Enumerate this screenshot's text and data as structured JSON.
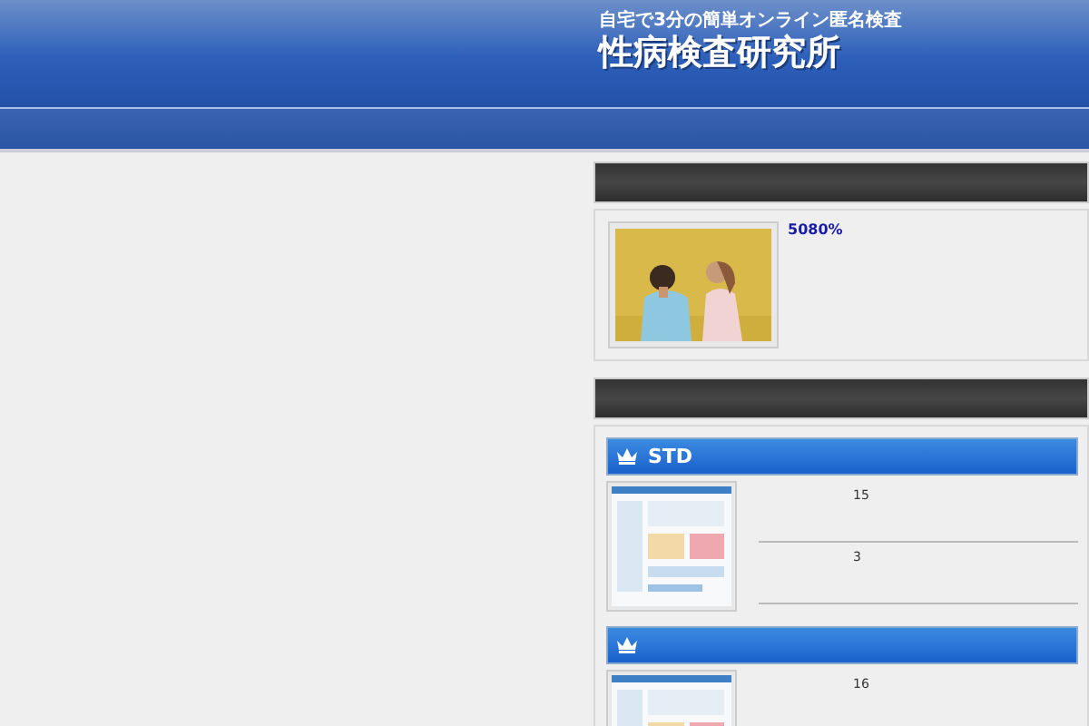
{
  "header": {
    "tagline": "自宅で3分の簡単オンライン匿名検査",
    "logo": "性病検査研究所"
  },
  "feature": {
    "caption": "5080%"
  },
  "rankings": [
    {
      "title": "STD",
      "entries": [
        {
          "rows": [
            "15",
            "3"
          ]
        }
      ]
    },
    {
      "entries": [
        {
          "rows": [
            "16"
          ]
        }
      ]
    }
  ]
}
